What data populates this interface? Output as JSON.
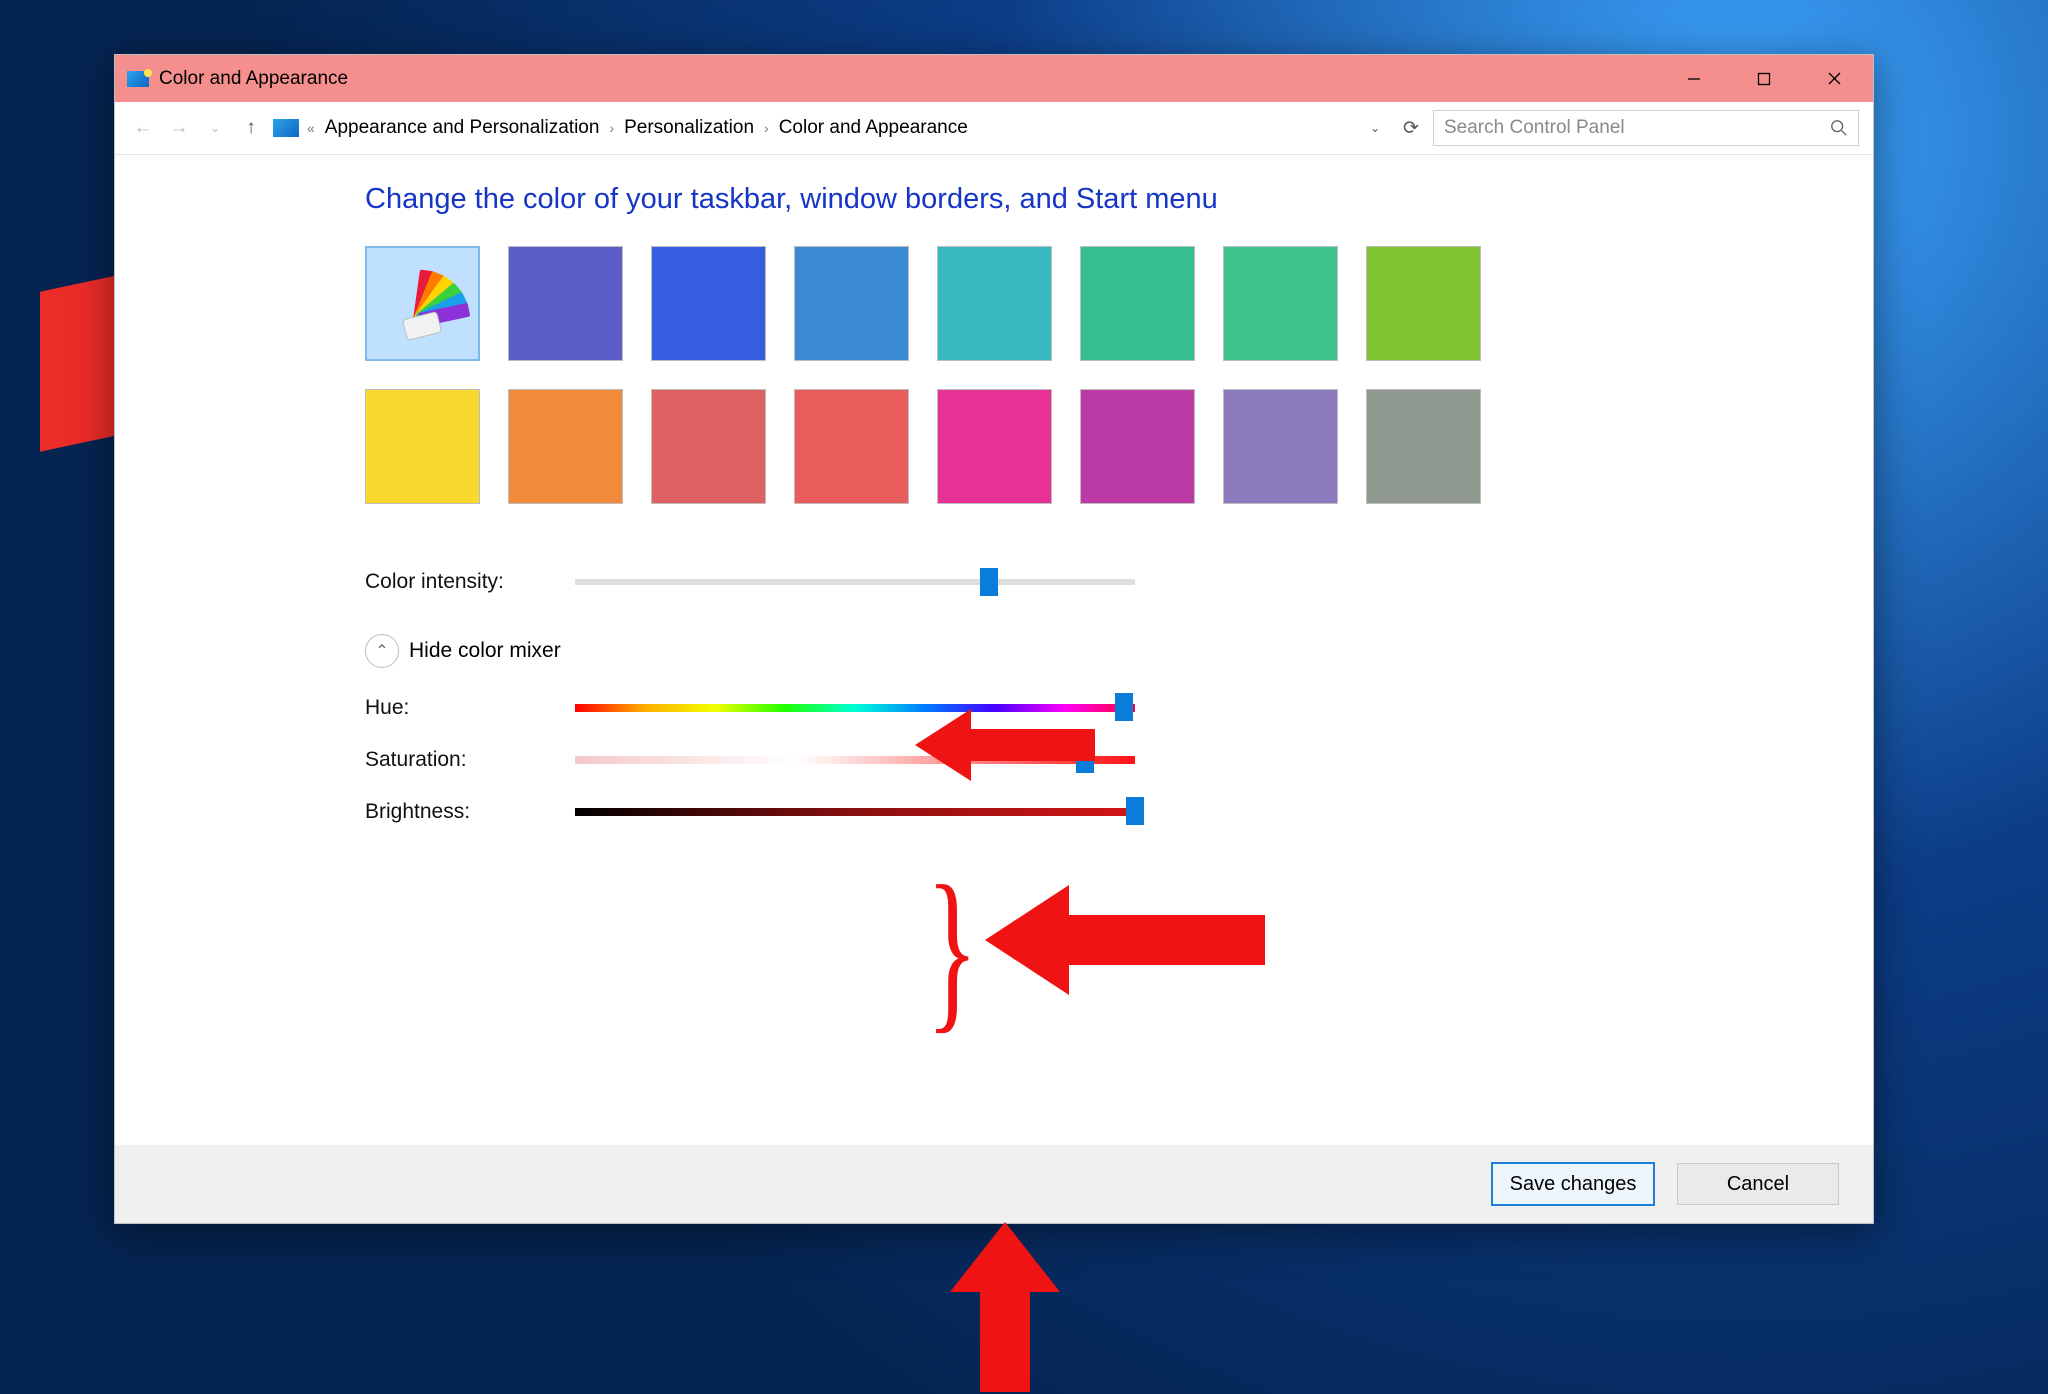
{
  "window": {
    "title": "Color and Appearance"
  },
  "breadcrumbs": {
    "ell": "«",
    "a": "Appearance and Personalization",
    "b": "Personalization",
    "c": "Color and Appearance"
  },
  "search": {
    "placeholder": "Search Control Panel"
  },
  "heading": "Change the color of your taskbar, window borders, and Start menu",
  "swatches": {
    "row1": [
      "auto",
      "#5d5dc7",
      "#375de0",
      "#3a8bd3",
      "#37b9bf",
      "#37bf94",
      "#3ec48b",
      "#80c331"
    ],
    "row2": [
      "#f9d92d",
      "#f18a3a",
      "#dd6161",
      "#e85c5c",
      "#e63294",
      "#bb3aa6",
      "#8d7bbf",
      "#8f9990"
    ]
  },
  "labels": {
    "intensity": "Color intensity:",
    "mixer_toggle": "Hide color mixer",
    "hue": "Hue:",
    "sat": "Saturation:",
    "bri": "Brightness:"
  },
  "sliders": {
    "intensity_pct": 74,
    "hue_pct": 98,
    "sat_pct": 91,
    "bri_pct": 100
  },
  "buttons": {
    "save": "Save changes",
    "cancel": "Cancel"
  }
}
